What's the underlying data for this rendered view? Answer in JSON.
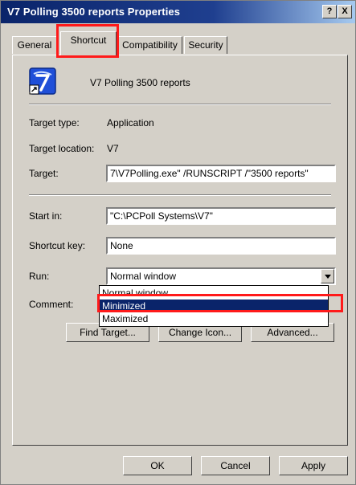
{
  "window": {
    "title": "V7 Polling 3500 reports Properties",
    "help_btn": "?",
    "close_btn": "X"
  },
  "tabs": [
    {
      "label": "General"
    },
    {
      "label": "Shortcut"
    },
    {
      "label": "Compatibility"
    },
    {
      "label": "Security"
    }
  ],
  "shortcut": {
    "name": "V7 Polling 3500 reports",
    "target_type_label": "Target type:",
    "target_type_value": "Application",
    "target_location_label": "Target location:",
    "target_location_value": "V7",
    "target_label": "Target:",
    "target_value": "7\\V7Polling.exe\" /RUNSCRIPT /\"3500 reports\"",
    "start_in_label": "Start in:",
    "start_in_value": "\"C:\\PCPoll Systems\\V7\"",
    "shortcut_key_label": "Shortcut key:",
    "shortcut_key_value": "None",
    "run_label": "Run:",
    "run_value": "Normal window",
    "run_options": [
      "Normal window",
      "Minimized",
      "Maximized"
    ],
    "comment_label": "Comment:",
    "find_target_btn": "Find Target...",
    "change_icon_btn": "Change Icon...",
    "advanced_btn": "Advanced..."
  },
  "footer": {
    "ok": "OK",
    "cancel": "Cancel",
    "apply": "Apply"
  },
  "colors": {
    "title_bar": "#0a246a",
    "selection": "#0a246a",
    "highlight_box": "#ff1a1a",
    "face": "#d4d0c8"
  },
  "icons": {
    "app": "v7-app-shortcut-icon"
  }
}
